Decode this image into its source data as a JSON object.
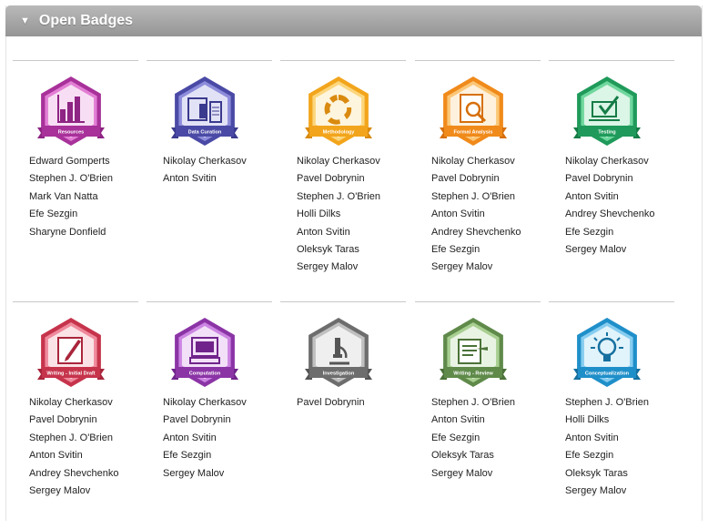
{
  "panel": {
    "title": "Open Badges",
    "toggle_icon": "triangle-down-icon"
  },
  "badges": [
    {
      "label": "Resources",
      "icon": "bar-chart-icon",
      "color": "#a8319a",
      "light": "#e27ed4",
      "band": "#8e2483",
      "contributors": [
        "Edward Gomperts",
        "Stephen J. O'Brien",
        "Mark Van Natta",
        "Efe Sezgin",
        "Sharyne Donfield"
      ]
    },
    {
      "label": "Data Curation",
      "icon": "data-stack-icon",
      "color": "#4a4aa6",
      "light": "#8d8ddb",
      "band": "#3a3a8e",
      "contributors": [
        "Nikolay Cherkasov",
        "Anton Svitin"
      ]
    },
    {
      "label": "Methodology",
      "icon": "cycle-arrows-icon",
      "color": "#f2a51c",
      "light": "#fcd67c",
      "band": "#d98a0f",
      "contributors": [
        "Nikolay Cherkasov",
        "Pavel Dobrynin",
        "Stephen J. O'Brien",
        "Holli Dilks",
        "Anton Svitin",
        "Oleksyk Taras",
        "Sergey Malov"
      ]
    },
    {
      "label": "Formal Analysis",
      "icon": "magnifier-document-icon",
      "color": "#f08a1a",
      "light": "#fbc777",
      "band": "#d66f0b",
      "contributors": [
        "Nikolay Cherkasov",
        "Pavel Dobrynin",
        "Stephen J. O'Brien",
        "Anton Svitin",
        "Andrey Shevchenko",
        "Efe Sezgin",
        "Sergey Malov"
      ]
    },
    {
      "label": "Testing",
      "icon": "checkmark-screen-icon",
      "color": "#1f9a5a",
      "light": "#6fd79d",
      "band": "#157c46",
      "contributors": [
        "Nikolay Cherkasov",
        "Pavel Dobrynin",
        "Anton Svitin",
        "Andrey Shevchenko",
        "Efe Sezgin",
        "Sergey Malov"
      ]
    },
    {
      "label": "Writing - Initial Draft",
      "icon": "pen-paper-icon",
      "color": "#c6344c",
      "light": "#ef8a9c",
      "band": "#a9253b",
      "contributors": [
        "Nikolay Cherkasov",
        "Pavel Dobrynin",
        "Stephen J. O'Brien",
        "Anton Svitin",
        "Andrey Shevchenko",
        "Sergey Malov"
      ]
    },
    {
      "label": "Computation",
      "icon": "computer-icon",
      "color": "#8b34a6",
      "light": "#cc85e2",
      "band": "#70248b",
      "contributors": [
        "Nikolay Cherkasov",
        "Pavel Dobrynin",
        "Anton Svitin",
        "Efe Sezgin",
        "Sergey Malov"
      ]
    },
    {
      "label": "Investigation",
      "icon": "microscope-icon",
      "color": "#6d6d6d",
      "light": "#c0c0c0",
      "band": "#555555",
      "contributors": [
        "Pavel Dobrynin"
      ]
    },
    {
      "label": "Writing - Review",
      "icon": "edit-document-icon",
      "color": "#5f8a4a",
      "light": "#a8cf91",
      "band": "#4b7238",
      "contributors": [
        "Stephen J. O'Brien",
        "Anton Svitin",
        "Efe Sezgin",
        "Oleksyk Taras",
        "Sergey Malov"
      ]
    },
    {
      "label": "Conceptualization",
      "icon": "lightbulb-icon",
      "color": "#1f8fc9",
      "light": "#86cdf0",
      "band": "#16709f",
      "contributors": [
        "Stephen J. O'Brien",
        "Holli Dilks",
        "Anton Svitin",
        "Efe Sezgin",
        "Oleksyk Taras",
        "Sergey Malov"
      ]
    }
  ]
}
